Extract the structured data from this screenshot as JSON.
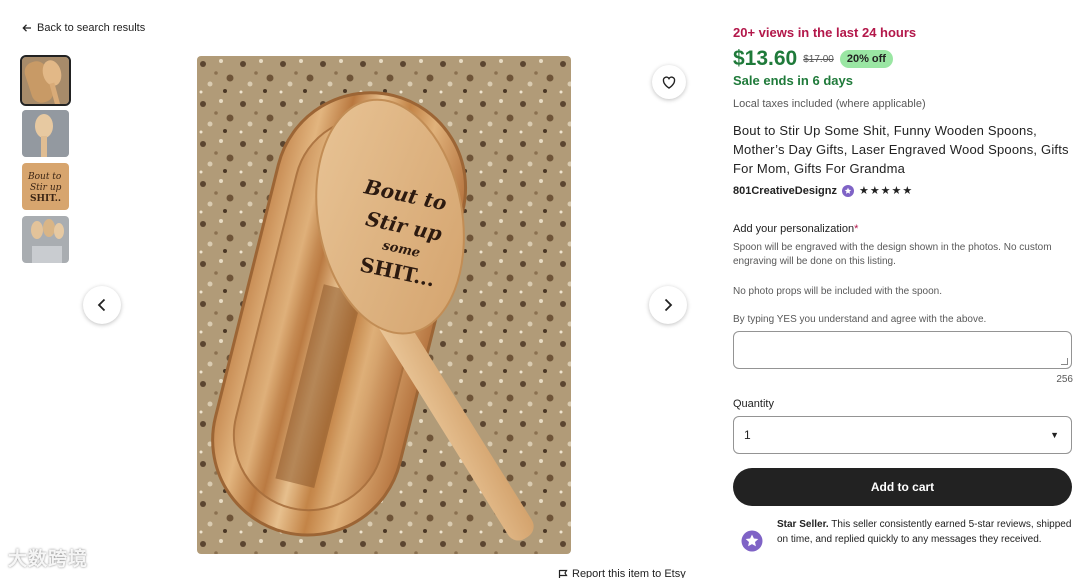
{
  "nav": {
    "back_label": "Back to search results"
  },
  "gallery": {
    "thumbnails": [
      "Spoon on bamboo rest",
      "Spoon on grey granite",
      "Engraved spoon close-up",
      "Spoons in holder"
    ],
    "engraving_text": [
      "Bout to",
      "Stir up",
      "some",
      "SHIT..."
    ],
    "favorite_label": "Add to favorites",
    "prev_label": "Previous image",
    "next_label": "Next image",
    "report_label": "Report this item to Etsy"
  },
  "watermark": "大数跨境",
  "listing": {
    "views": "20+ views in the last 24 hours",
    "price": "$13.60",
    "old_price": "$17.00",
    "discount": "20% off",
    "sale_ends": "Sale ends in 6 days",
    "taxes": "Local taxes included (where applicable)",
    "title": "Bout to Stir Up Some Shit, Funny Wooden Spoons, Mother’s Day Gifts, Laser Engraved Wood Spoons, Gifts For Mom, Gifts For Grandma",
    "seller": "801CreativeDesignz",
    "rating_stars": "★★★★★",
    "rating": 5
  },
  "personalization": {
    "label": "Add your personalization",
    "required_mark": "*",
    "note1": "Spoon will be engraved with the design shown in the photos. No custom engraving will be done on this listing.",
    "note2": "No photo props will be included with the spoon.",
    "note3": "By typing YES you understand and agree with the above.",
    "value": "",
    "char_count": "256"
  },
  "quantity": {
    "label": "Quantity",
    "selected": "1"
  },
  "cart": {
    "add_label": "Add to cart"
  },
  "star_seller": {
    "title": "Star Seller.",
    "text": " This seller consistently earned 5-star reviews, shipped on time, and replied quickly to any messages they received."
  },
  "colors": {
    "views": "#b3174a",
    "price": "#1f7a3a",
    "discount_bg": "#9ae6a3",
    "button_bg": "#222222",
    "star_seller_badge": "#7f63c6"
  }
}
